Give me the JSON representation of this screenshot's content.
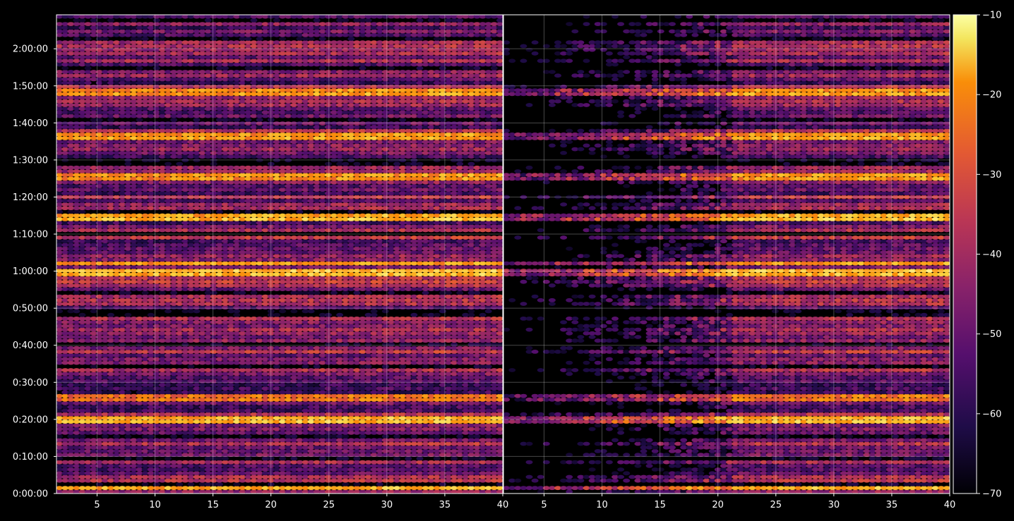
{
  "chart_data": {
    "type": "heatmap",
    "title": "",
    "panels": [
      {
        "name": "",
        "x_ticks": [
          5,
          10,
          15,
          20,
          25,
          30,
          35,
          40
        ],
        "xlim": [
          1.5,
          40
        ],
        "ylim_seconds": [
          0,
          7750
        ],
        "y_tick_labels": [
          "0:00:00",
          "0:10:00",
          "0:20:00",
          "0:30:00",
          "0:40:00",
          "0:50:00",
          "1:00:00",
          "1:10:00",
          "1:20:00",
          "1:30:00",
          "1:40:00",
          "1:50:00",
          "2:00:00"
        ],
        "y_tick_seconds": [
          0,
          600,
          1200,
          1800,
          2400,
          3000,
          3600,
          4200,
          4800,
          5400,
          6000,
          6600,
          7200
        ],
        "grid": true,
        "bright_rows": [
          {
            "time": "0:01:30",
            "level": -25
          },
          {
            "time": "0:19:45",
            "level": -25
          },
          {
            "time": "0:25:30",
            "level": -32
          },
          {
            "time": "1:00:00",
            "level": -24
          },
          {
            "time": "1:02:00",
            "level": -26
          },
          {
            "time": "1:14:30",
            "level": -24
          },
          {
            "time": "1:25:30",
            "level": -28
          },
          {
            "time": "1:36:30",
            "level": -28
          },
          {
            "time": "1:48:30",
            "level": -27
          }
        ],
        "gaps": [
          {
            "from": "1:09:30",
            "to": "1:11:00"
          }
        ]
      },
      {
        "name": "",
        "x_ticks": [
          5,
          10,
          15,
          20,
          25,
          30,
          35,
          40
        ],
        "xlim": [
          1.5,
          40
        ],
        "ylim_seconds": [
          0,
          7750
        ],
        "dim_region_below_x": 21,
        "bright_rows": [
          {
            "time": "0:25:30",
            "level": -30
          },
          {
            "time": "0:42:00",
            "level": -34
          },
          {
            "time": "1:48:30",
            "level": -30
          }
        ]
      }
    ],
    "colorbar": {
      "colormap": "inferno",
      "vmin": -70,
      "vmax": -10,
      "ticks": [
        "−70",
        "−60",
        "−50",
        "−40",
        "−30",
        "−20",
        "−10"
      ],
      "tick_values": [
        -70,
        -60,
        -50,
        -40,
        -30,
        -20,
        -10
      ]
    }
  }
}
